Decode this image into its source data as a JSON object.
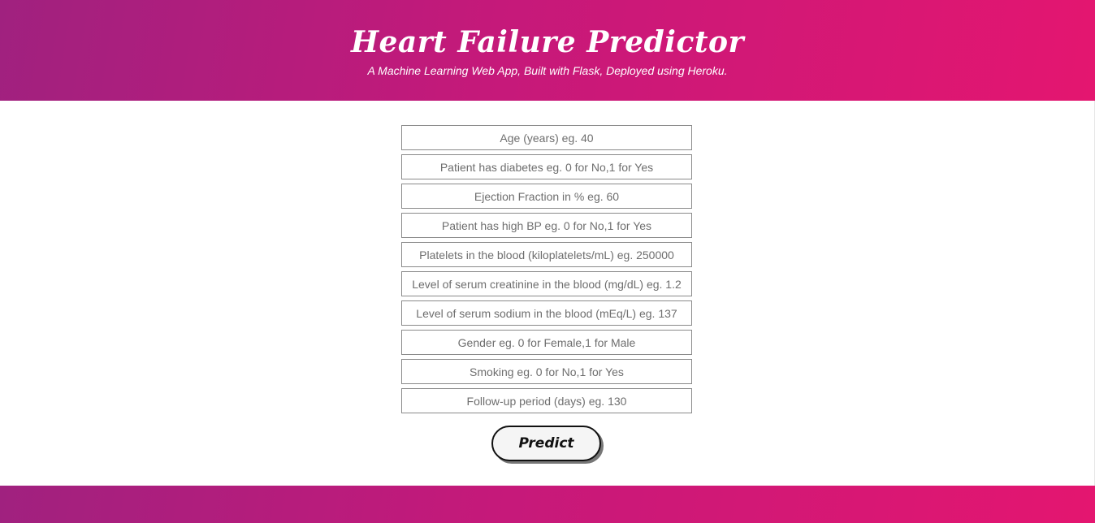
{
  "header": {
    "title": "Heart Failure Predictor",
    "subtitle": "A Machine Learning Web App, Built with Flask, Deployed using Heroku."
  },
  "form": {
    "fields": [
      {
        "placeholder": "Age (years) eg. 40",
        "value": ""
      },
      {
        "placeholder": "Patient has diabetes eg. 0 for No,1 for Yes",
        "value": ""
      },
      {
        "placeholder": "Ejection Fraction in % eg. 60",
        "value": ""
      },
      {
        "placeholder": "Patient has high BP eg. 0 for No,1 for Yes",
        "value": ""
      },
      {
        "placeholder": "Platelets in the blood (kiloplatelets/mL) eg. 250000",
        "value": ""
      },
      {
        "placeholder": "Level of serum creatinine in the blood (mg/dL) eg. 1.2",
        "value": ""
      },
      {
        "placeholder": "Level of serum sodium in the blood (mEq/L) eg. 137",
        "value": ""
      },
      {
        "placeholder": "Gender eg. 0 for Female,1 for Male",
        "value": ""
      },
      {
        "placeholder": "Smoking eg. 0 for No,1 for Yes",
        "value": ""
      },
      {
        "placeholder": "Follow-up period (days) eg. 130",
        "value": ""
      }
    ],
    "submit_label": "Predict"
  },
  "colors": {
    "gradient_start": "#a0217f",
    "gradient_end": "#e41670"
  }
}
